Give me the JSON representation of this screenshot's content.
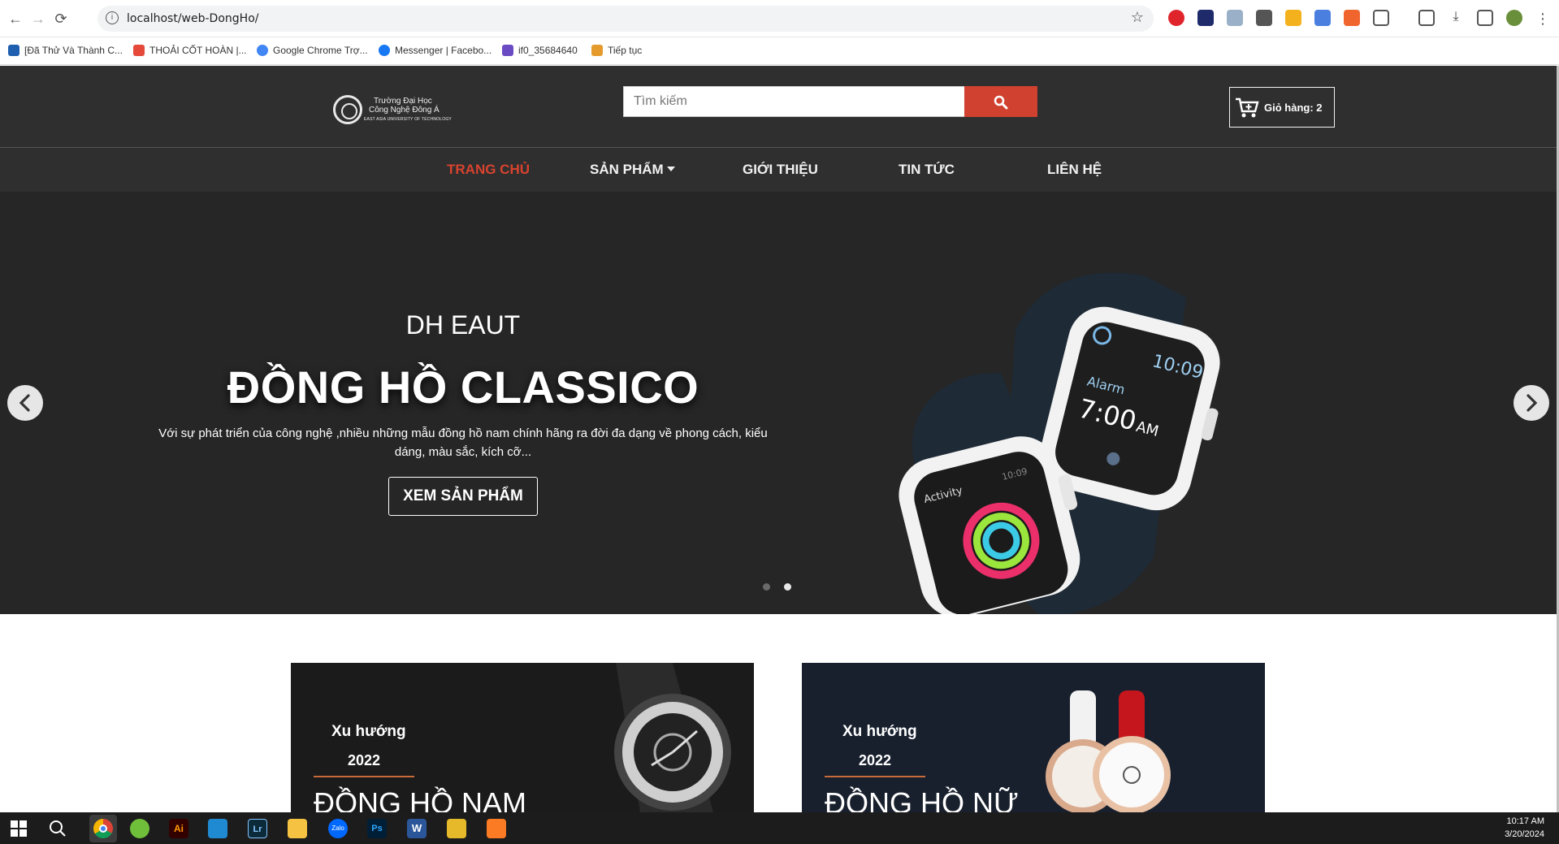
{
  "browser": {
    "url": "localhost/web-DongHo/",
    "bookmarks": [
      {
        "label": "[Đã Thử Và Thành C...",
        "color": "#1f5fb0"
      },
      {
        "label": "THOẢI CỐT HOÀN |...",
        "color": "#e4493a"
      },
      {
        "label": "Google Chrome Trợ...",
        "color": "#4285f4"
      },
      {
        "label": "Messenger | Facebo...",
        "color": "#1877f2"
      },
      {
        "label": "if0_35684640",
        "color": "#6a4bc4"
      },
      {
        "label": "Tiếp tục",
        "color": "#e59a2c"
      }
    ]
  },
  "header": {
    "logo": {
      "line1": "Trường Đại Học",
      "line2": "Công Nghệ Đông Á",
      "line3": "EAST ASIA UNIVERSITY OF TECHNOLOGY"
    },
    "search_placeholder": "Tìm kiếm",
    "cart_label": "Giỏ hàng: 2"
  },
  "nav": [
    {
      "label": "TRANG CHỦ",
      "active": true
    },
    {
      "label": "SẢN PHẨM",
      "dropdown": true
    },
    {
      "label": "GIỚI THIỆU"
    },
    {
      "label": "TIN TỨC"
    },
    {
      "label": "LIÊN HỆ"
    }
  ],
  "hero": {
    "subtitle": "DH EAUT",
    "title": "ĐỒNG HỒ CLASSICO",
    "description": "Với sự phát triển của công nghệ ,nhiều những mẫu đồng hồ nam chính hãng ra đời đa dạng về phong cách, kiểu dáng, màu sắc, kích cỡ...",
    "cta": "XEM SẢN PHẨM",
    "slide_count": 2,
    "active_slide": 2,
    "watch_screen": {
      "time": "10:09",
      "label": "Alarm",
      "alarm": "7:00",
      "ampm": "AM",
      "activity": "Activity",
      "activity_time": "10:09"
    }
  },
  "banners": [
    {
      "trend": "Xu hướng",
      "year": "2022",
      "title": "ĐỒNG HỒ NAM",
      "bg": "#1b1b1b"
    },
    {
      "trend": "Xu hướng",
      "year": "2022",
      "title": "ĐỒNG HỒ NỮ",
      "bg": "#18202e"
    }
  ],
  "taskbar": {
    "time": "10:17 AM",
    "date": "3/20/2024"
  },
  "colors": {
    "accent": "#d0412f",
    "header_bg": "#2f2f2f",
    "hero_bg": "#262626"
  }
}
